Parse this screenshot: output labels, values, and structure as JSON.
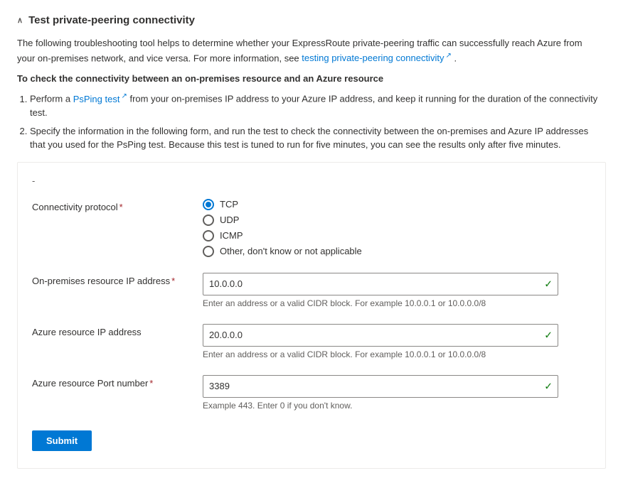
{
  "header": {
    "title": "Test private-peering connectivity",
    "collapse_icon": "chevron-up"
  },
  "description": {
    "text1": "The following troubleshooting tool helps to determine whether your ExpressRoute private-peering traffic can successfully reach Azure from your on-premises network, and vice versa. For more information, see ",
    "link_text": "testing private-peering connectivity",
    "text2": "."
  },
  "bold_instruction": "To check the connectivity between an on-premises resource and an Azure resource",
  "steps": [
    {
      "id": 1,
      "text_before": "Perform a ",
      "link_text": "PsPing test",
      "text_after": " from your on-premises IP address to your Azure IP address, and keep it running for the duration of the connectivity test."
    },
    {
      "id": 2,
      "text": "Specify the information in the following form, and run the test to check the connectivity between the on-premises and Azure IP addresses that you used for the PsPing test. Because this test is tuned to run for five minutes, you can see the results only after five minutes."
    }
  ],
  "form": {
    "dash": "-",
    "connectivity_protocol": {
      "label": "Connectivity protocol",
      "required": true,
      "options": [
        {
          "value": "TCP",
          "label": "TCP",
          "checked": true
        },
        {
          "value": "UDP",
          "label": "UDP",
          "checked": false
        },
        {
          "value": "ICMP",
          "label": "ICMP",
          "checked": false
        },
        {
          "value": "OTHER",
          "label": "Other, don't know or not applicable",
          "checked": false
        }
      ]
    },
    "on_premises_ip": {
      "label": "On-premises resource IP address",
      "required": true,
      "value": "10.0.0.0",
      "hint": "Enter an address or a valid CIDR block. For example 10.0.0.1 or 10.0.0.0/8"
    },
    "azure_ip": {
      "label": "Azure resource IP address",
      "required": false,
      "value": "20.0.0.0",
      "hint": "Enter an address or a valid CIDR block. For example 10.0.0.1 or 10.0.0.0/8"
    },
    "port_number": {
      "label": "Azure resource Port number",
      "required": true,
      "value": "3389",
      "hint": "Example 443. Enter 0 if you don't know."
    },
    "submit_label": "Submit"
  }
}
